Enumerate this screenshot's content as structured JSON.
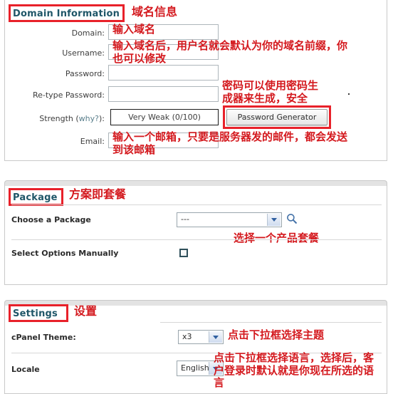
{
  "sections": {
    "domain": {
      "title": "Domain Information",
      "annotation": "域名信息",
      "fields": {
        "domain_label": "Domain:",
        "username_label": "Username:",
        "password_label": "Password:",
        "retype_label": "Re-type Password:",
        "strength_label": "Strength (",
        "strength_why": "why?",
        "strength_label_end": "):",
        "email_label": "Email:",
        "strength_value": "Very Weak (0/100)",
        "password_generator_button": "Password Generator",
        "domain_value": "",
        "username_value": "",
        "password_value": "",
        "retype_value": "",
        "email_value": ""
      },
      "notes": {
        "domain_note": "输入域名",
        "username_note": "输入域名后，用户名就会默认为你的域名前缀，你\n也可以修改",
        "password_note": "密码可以使用密码生\n成器来生成，安全",
        "email_note": "输入一个邮箱，只要是服务器发的邮件，都会发送\n到该邮箱"
      }
    },
    "package": {
      "title": "Package",
      "annotation": "方案即套餐",
      "choose_label": "Choose a Package",
      "choose_value": "---",
      "choose_note": "选择一个产品套餐",
      "manual_label": "Select Options Manually",
      "manual_checked": false
    },
    "settings": {
      "title": "Settings",
      "annotation": "设置",
      "theme_label": "cPanel Theme:",
      "theme_value": "x3",
      "theme_note": "点击下拉框选择主题",
      "locale_label": "Locale",
      "locale_value": "English",
      "locale_note": "点击下拉框选择语言，选择后，客\n户登录时默认就是你现在所选的语\n言"
    }
  },
  "colors": {
    "annotation_red": "#d4191e",
    "box_red": "#e8212a",
    "section_title": "#1f5668",
    "link": "#5a7f8c"
  },
  "icons": {
    "search": "search-magnifier-icon",
    "caret": "chevron-down-icon"
  }
}
